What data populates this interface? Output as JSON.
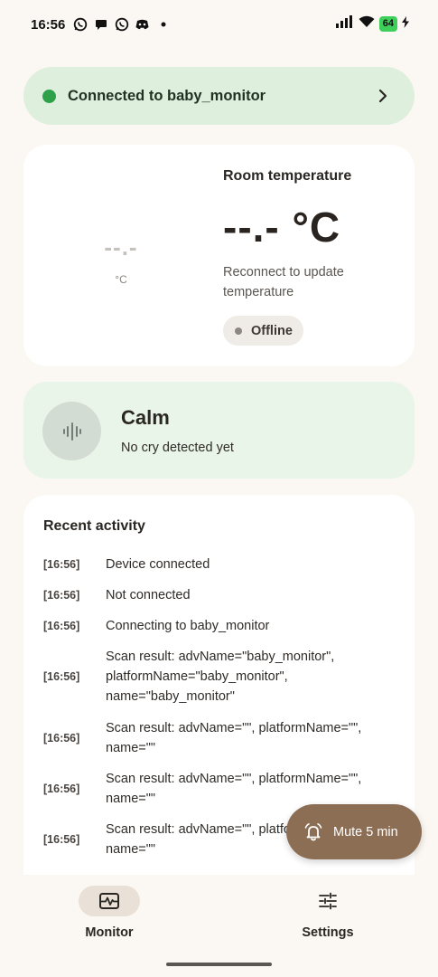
{
  "status_bar": {
    "time": "16:56",
    "battery": "64",
    "notification_icons": [
      "whatsapp-icon",
      "chat-icon",
      "whatsapp-icon",
      "discord-icon",
      "dot-icon"
    ]
  },
  "connection": {
    "text": "Connected to baby_monitor",
    "status_color": "#2ea04a"
  },
  "temperature": {
    "gauge_value": "--.-",
    "gauge_unit": "°C",
    "label": "Room temperature",
    "value": "--.- °C",
    "hint": "Reconnect to update temperature",
    "status": "Offline"
  },
  "cry": {
    "title": "Calm",
    "subtitle": "No cry detected yet"
  },
  "activity": {
    "title": "Recent activity",
    "entries": [
      {
        "time": "[16:56]",
        "message": "Device connected"
      },
      {
        "time": "[16:56]",
        "message": "Not connected"
      },
      {
        "time": "[16:56]",
        "message": "Connecting to baby_monitor"
      },
      {
        "time": "[16:56]",
        "message": "Scan result: advName=\"baby_monitor\", platformName=\"baby_monitor\", name=\"baby_monitor\""
      },
      {
        "time": "[16:56]",
        "message": "Scan result: advName=\"\", platformName=\"\", name=\"\""
      },
      {
        "time": "[16:56]",
        "message": "Scan result: advName=\"\", platformName=\"\", name=\"\""
      },
      {
        "time": "[16:56]",
        "message": "Scan result: advName=\"\", platformName=\"\", name=\"\""
      }
    ]
  },
  "mute_button": {
    "label": "Mute 5 min",
    "color": "#8c6e55"
  },
  "nav": {
    "items": [
      {
        "label": "Monitor",
        "icon": "waveform-icon",
        "active": true
      },
      {
        "label": "Settings",
        "icon": "sliders-icon",
        "active": false
      }
    ]
  }
}
